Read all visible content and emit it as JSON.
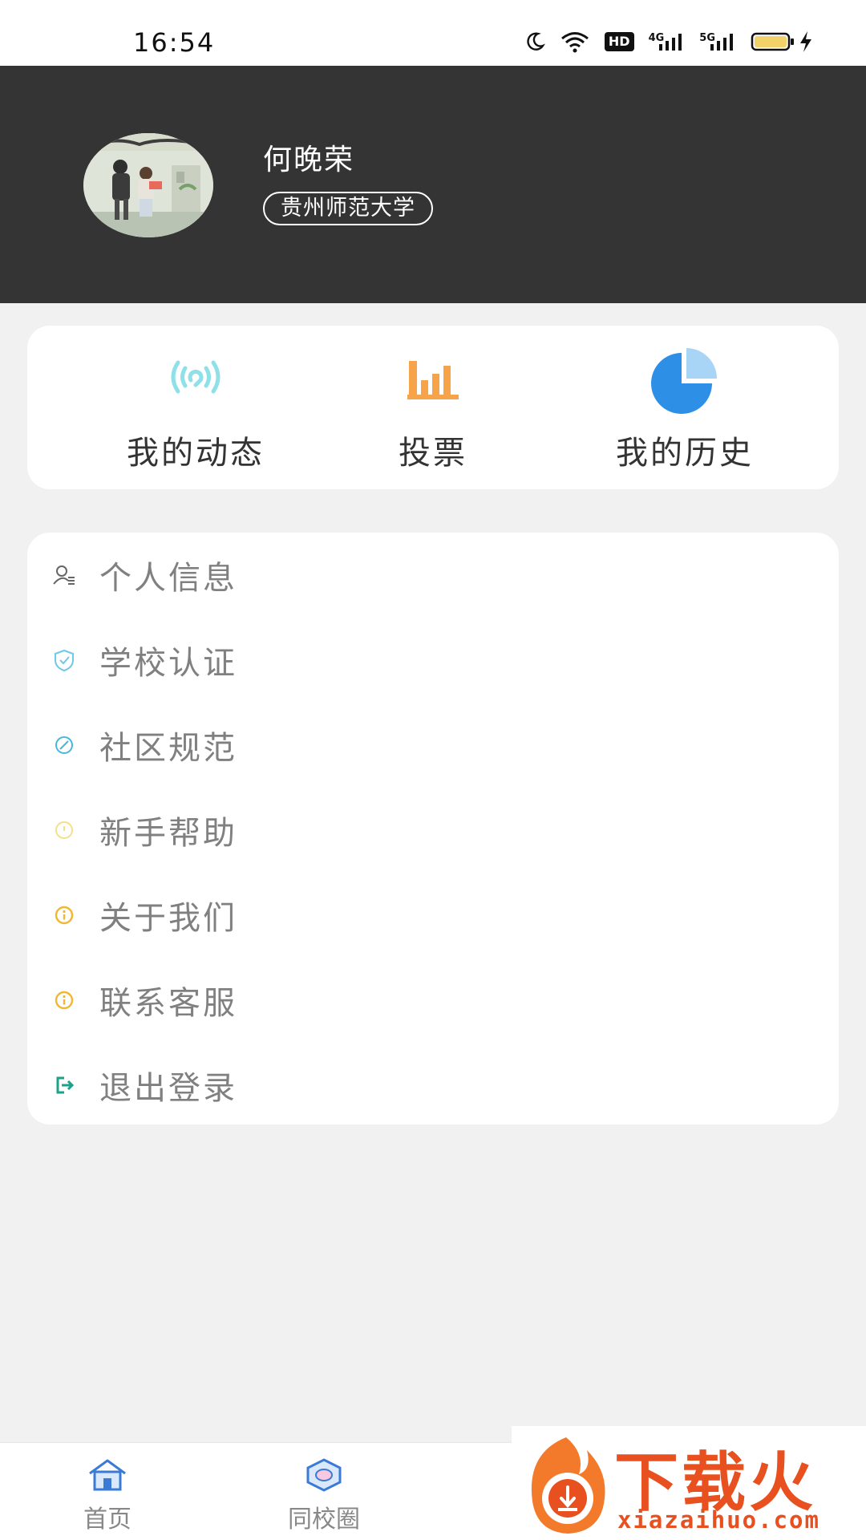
{
  "status_bar": {
    "time": "16:54",
    "hd_label": "HD",
    "net1_label": "4G",
    "net2_label": "5G",
    "icons": [
      "moon-icon",
      "wifi-icon",
      "hd-icon",
      "signal-4g-icon",
      "signal-5g-icon",
      "battery-icon",
      "charging-icon"
    ]
  },
  "profile": {
    "name": "何晚荣",
    "school": "贵州师范大学"
  },
  "quick_actions": [
    {
      "label": "我的动态",
      "icon": "broadcast-icon",
      "color": "#8fe0e8"
    },
    {
      "label": "投票",
      "icon": "bar-chart-icon",
      "color": "#f6a34a"
    },
    {
      "label": "我的历史",
      "icon": "pie-chart-icon",
      "color": "#2d8fe6"
    }
  ],
  "menu": [
    {
      "label": "个人信息",
      "icon": "user-info-icon",
      "color": "#666666"
    },
    {
      "label": "学校认证",
      "icon": "shield-icon",
      "color": "#6fc9e8"
    },
    {
      "label": "社区规范",
      "icon": "compass-icon",
      "color": "#49b6dd"
    },
    {
      "label": "新手帮助",
      "icon": "help-icon",
      "color": "#f3e08a"
    },
    {
      "label": "关于我们",
      "icon": "info-icon",
      "color": "#f0b72f"
    },
    {
      "label": "联系客服",
      "icon": "info-icon",
      "color": "#f0b72f"
    },
    {
      "label": "退出登录",
      "icon": "logout-icon",
      "color": "#1aa38a"
    }
  ],
  "bottom_nav": [
    {
      "label": "首页",
      "icon": "home-icon"
    },
    {
      "label": "同校圈",
      "icon": "campus-circle-icon"
    }
  ],
  "watermark": {
    "title": "下载火",
    "url": "xiazaihuo.com"
  }
}
